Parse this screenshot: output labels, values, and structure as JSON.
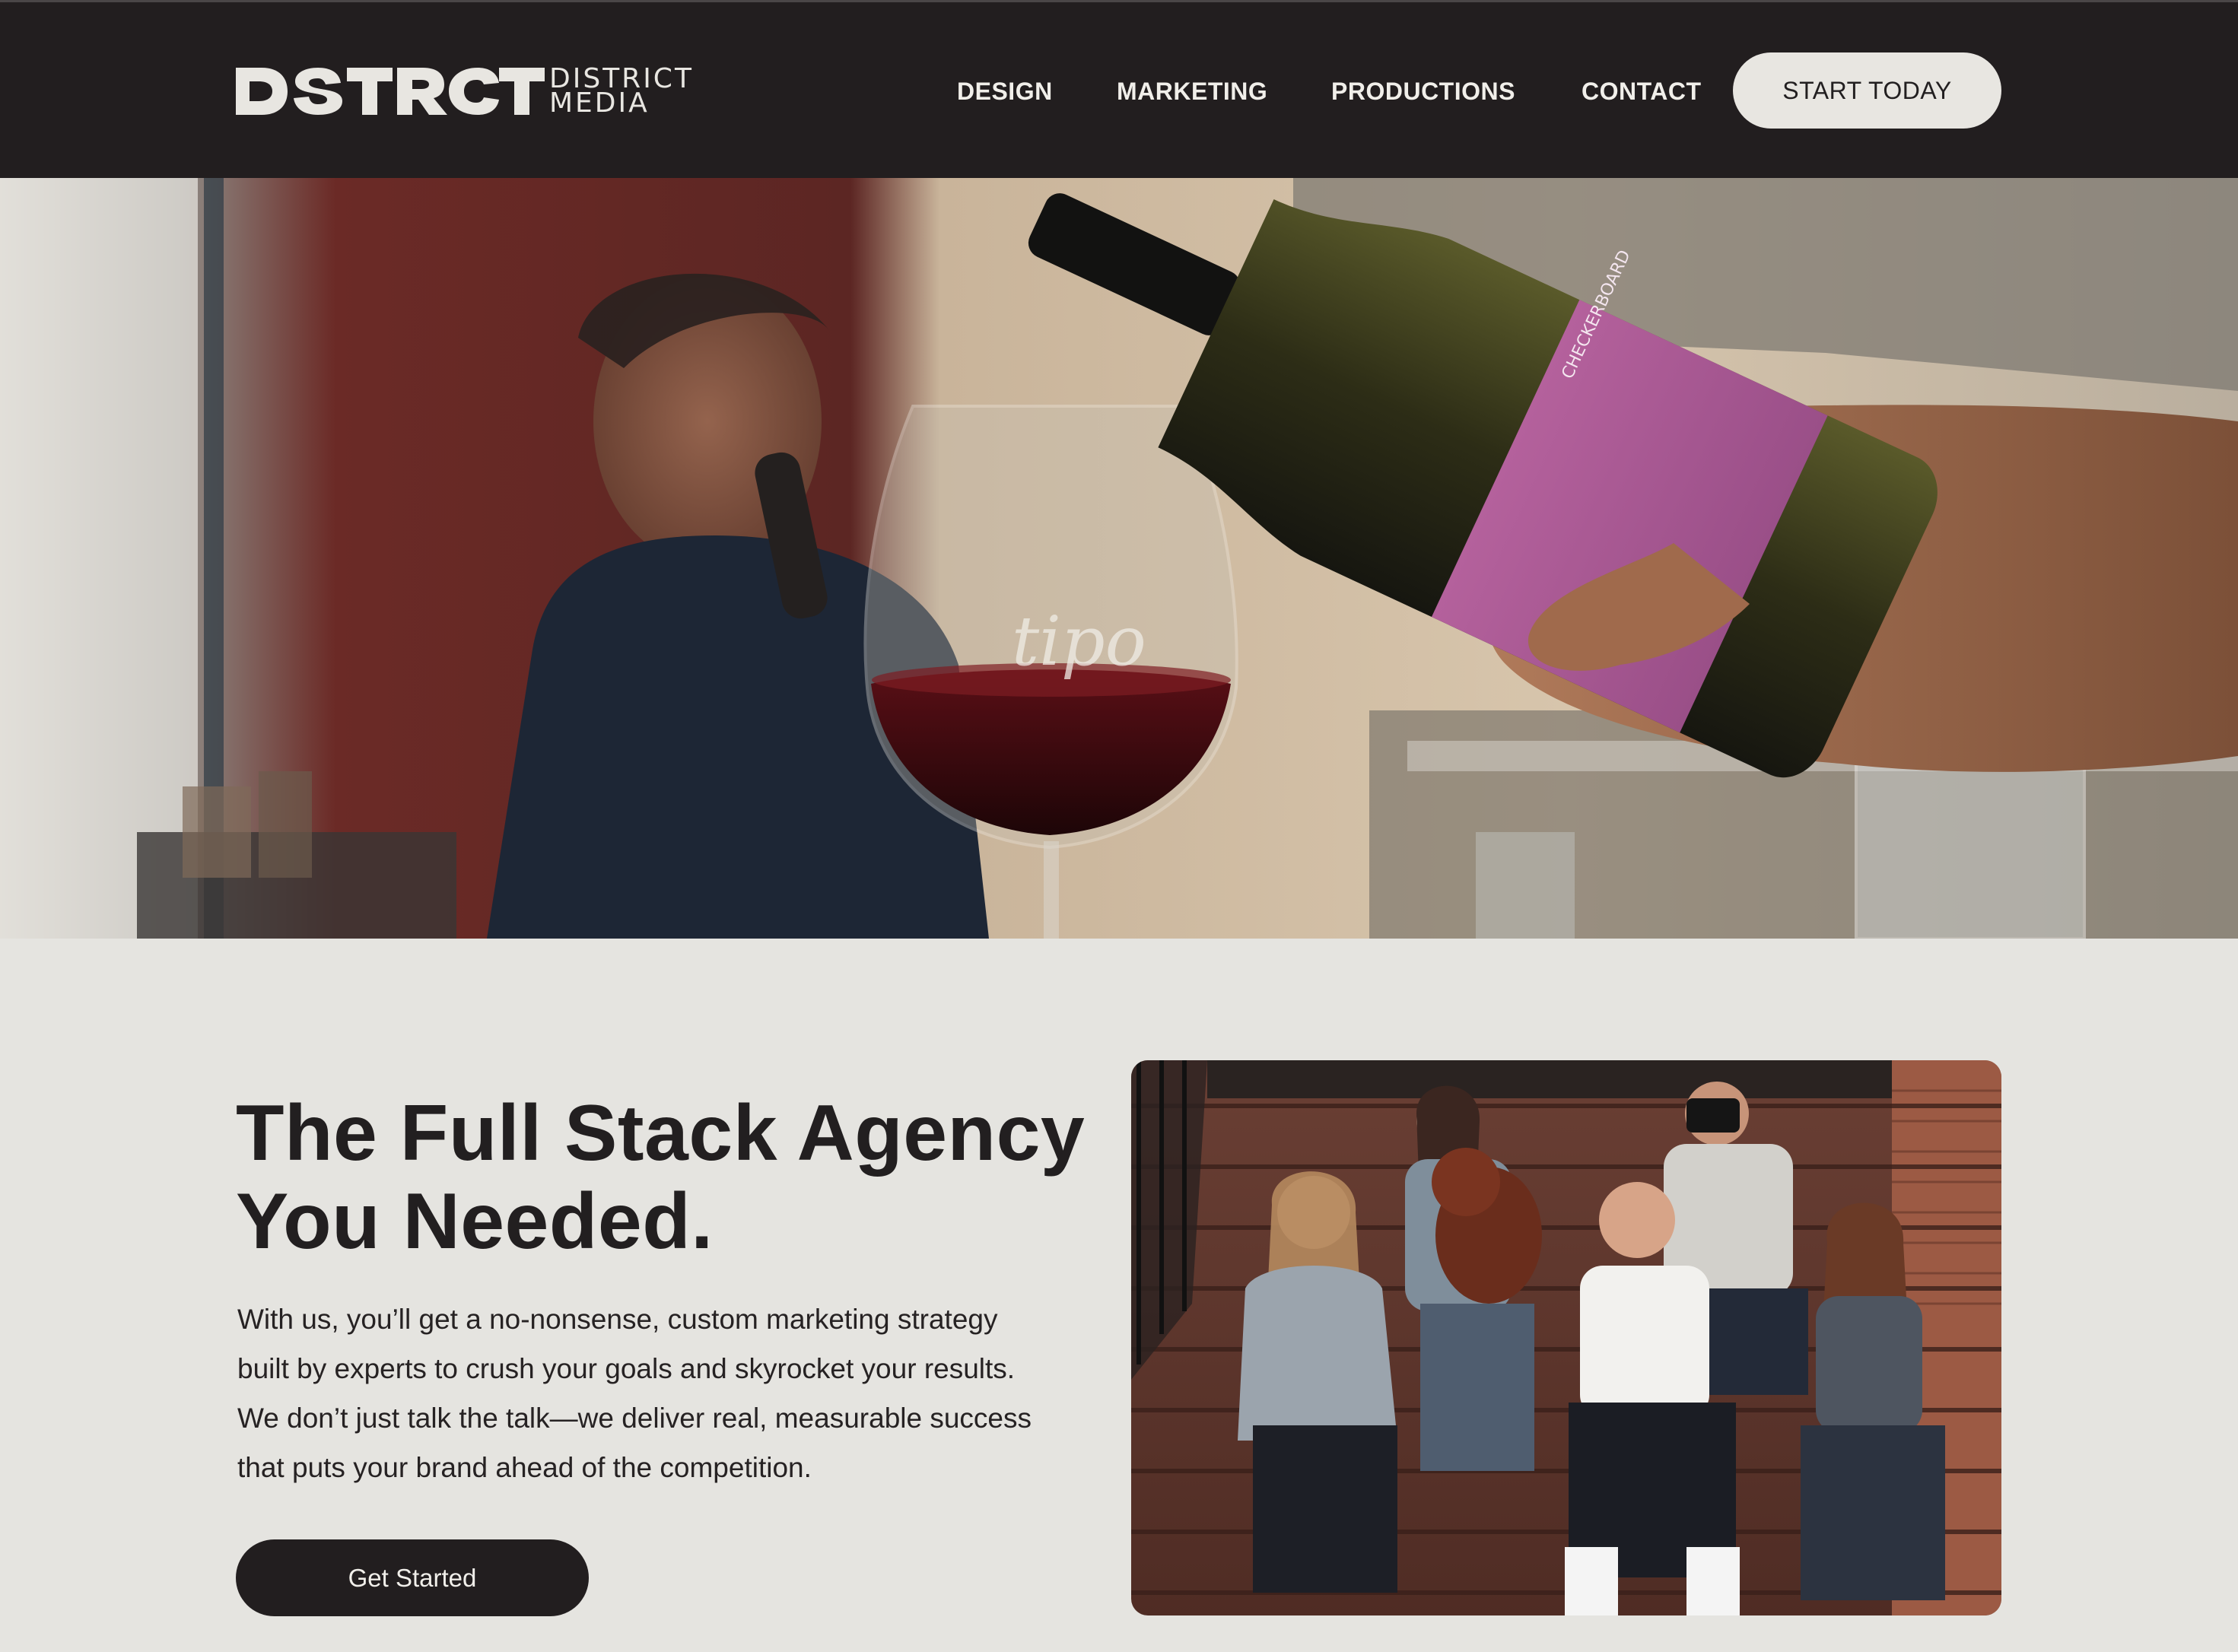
{
  "header": {
    "logo_mark_alt": "DSTRCT",
    "logo_line1": "DISTRICT",
    "logo_line2": "MEDIA",
    "nav": [
      "DESIGN",
      "MARKETING",
      "PRODUCTIONS",
      "CONTACT"
    ],
    "cta_label": "START TODAY"
  },
  "hero": {
    "image": "wine-pouring-into-glass-photo"
  },
  "main": {
    "headline_line1": "The Full Stack Agency",
    "headline_line2": "You Needed.",
    "body": [
      "With us, you’ll get a no-nonsense, custom marketing strategy",
      "built by experts to crush your goals and skyrocket your results.",
      "We don’t just talk the talk—we deliver real, measurable success",
      "that puts your brand ahead of the competition."
    ],
    "cta_label": "Get Started",
    "team_image": "team-sitting-on-stairs-photo"
  },
  "colors": {
    "header_bg": "#221e1f",
    "page_bg": "#e5e4e0",
    "text_dark": "#221f20",
    "light_button": "#e8e6e1"
  }
}
